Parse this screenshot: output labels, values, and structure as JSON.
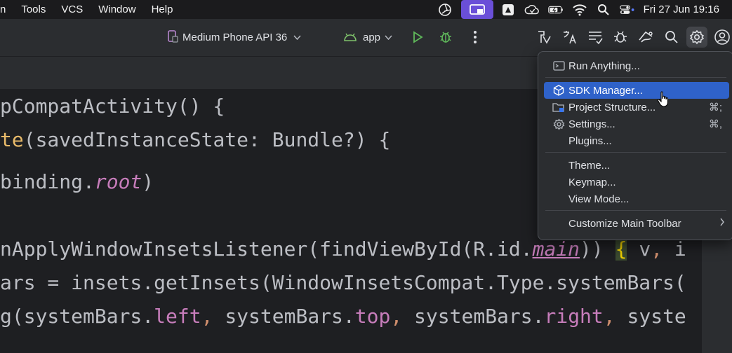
{
  "menubar": {
    "items": [
      "n",
      "Tools",
      "VCS",
      "Window",
      "Help"
    ],
    "clock": "Fri 27 Jun  19:16"
  },
  "toolbar": {
    "device": "Medium Phone API 36",
    "config": "app"
  },
  "editor": {
    "lines": [
      {
        "segments": [
          {
            "t": "pCompatActivity() {",
            "c": ""
          }
        ]
      },
      {
        "segments": [
          {
            "t": "te",
            "c": "fnc"
          },
          {
            "t": "(savedInstanceState: Bundle?) {",
            "c": ""
          }
        ]
      },
      {
        "segments": [
          {
            "t": "binding.",
            "c": ""
          },
          {
            "t": "root",
            "c": "italicp"
          },
          {
            "t": ")",
            "c": ""
          }
        ]
      },
      {
        "segments": [
          {
            "t": "nApplyWindowInsetsListener(findViewById(R.id.",
            "c": ""
          },
          {
            "t": "main",
            "c": "italicp ul"
          },
          {
            "t": ")) ",
            "c": ""
          },
          {
            "t": "{",
            "c": "brace"
          },
          {
            "t": " v",
            "c": ""
          },
          {
            "t": ",",
            "c": "orange"
          },
          {
            "t": " i",
            "c": ""
          }
        ]
      },
      {
        "segments": [
          {
            "t": "ars = insets.getInsets(WindowInsetsCompat.Type.systemBars(",
            "c": ""
          }
        ]
      },
      {
        "segments": [
          {
            "t": "g(systemBars.",
            "c": ""
          },
          {
            "t": "left",
            "c": "prop"
          },
          {
            "t": ", ",
            "c": "orange"
          },
          {
            "t": "systemBars.",
            "c": ""
          },
          {
            "t": "top",
            "c": "prop"
          },
          {
            "t": ", ",
            "c": "orange"
          },
          {
            "t": "systemBars.",
            "c": ""
          },
          {
            "t": "right",
            "c": "prop"
          },
          {
            "t": ", ",
            "c": "orange"
          },
          {
            "t": "syste",
            "c": ""
          }
        ]
      }
    ]
  },
  "popup": {
    "run_anything": "Run Anything...",
    "sdk_manager": "SDK Manager...",
    "project_structure": "Project Structure...",
    "project_structure_shortcut": "⌘;",
    "settings": "Settings...",
    "settings_shortcut": "⌘,",
    "plugins": "Plugins...",
    "theme": "Theme...",
    "keymap": "Keymap...",
    "view_mode": "View Mode...",
    "customize": "Customize Main Toolbar"
  },
  "colors": {
    "accent": "#2f62c9",
    "menubar_active": "#6a4fd8"
  }
}
